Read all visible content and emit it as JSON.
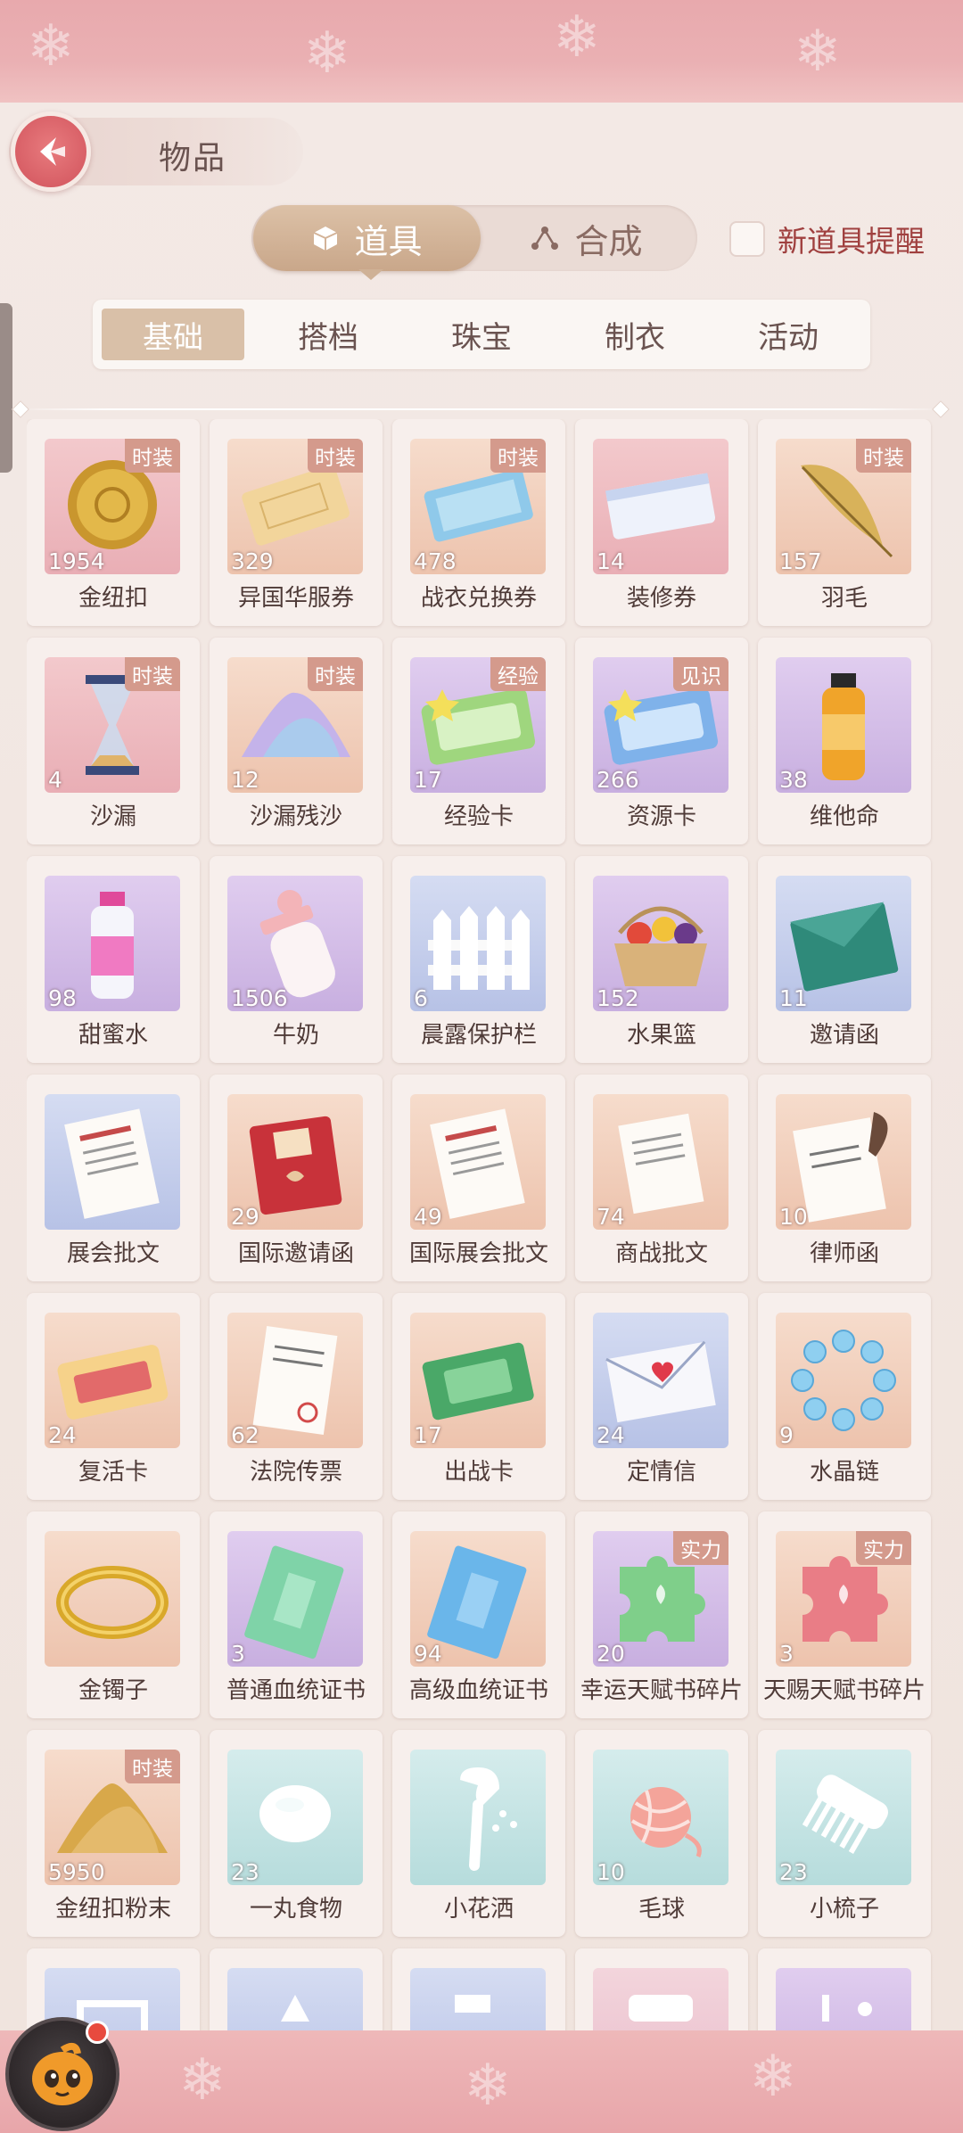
{
  "header": {
    "title": "物品"
  },
  "main_tabs": [
    {
      "label": "道具",
      "icon": "cube-icon",
      "active": true
    },
    {
      "label": "合成",
      "icon": "synthesis-icon",
      "active": false
    }
  ],
  "reminder": {
    "label": "新道具提醒",
    "checked": false
  },
  "sub_tabs": [
    {
      "label": "基础",
      "active": true
    },
    {
      "label": "搭档",
      "active": false
    },
    {
      "label": "珠宝",
      "active": false
    },
    {
      "label": "制衣",
      "active": false
    },
    {
      "label": "活动",
      "active": false
    }
  ],
  "items": [
    {
      "name": "金纽扣",
      "count": "1954",
      "badge": "时装",
      "bg": "pink",
      "icon": "gold-button-icon"
    },
    {
      "name": "异国华服券",
      "count": "329",
      "badge": "时装",
      "bg": "orange",
      "icon": "ticket-icon"
    },
    {
      "name": "战衣兑换券",
      "count": "478",
      "badge": "时装",
      "bg": "orange",
      "icon": "blue-ticket-icon"
    },
    {
      "name": "装修券",
      "count": "14",
      "badge": "",
      "bg": "pink",
      "icon": "decoration-ticket-icon"
    },
    {
      "name": "羽毛",
      "count": "157",
      "badge": "时装",
      "bg": "orange",
      "icon": "feather-icon"
    },
    {
      "name": "沙漏",
      "count": "4",
      "badge": "时装",
      "bg": "pink",
      "icon": "hourglass-icon"
    },
    {
      "name": "沙漏残沙",
      "count": "12",
      "badge": "时装",
      "bg": "orange",
      "icon": "sand-pile-icon"
    },
    {
      "name": "经验卡",
      "count": "17",
      "badge": "经验",
      "bg": "purple",
      "icon": "exp-card-icon"
    },
    {
      "name": "资源卡",
      "count": "266",
      "badge": "见识",
      "bg": "purple",
      "icon": "resource-card-icon"
    },
    {
      "name": "维他命",
      "count": "38",
      "badge": "",
      "bg": "purple",
      "icon": "vitamin-bottle-icon"
    },
    {
      "name": "甜蜜水",
      "count": "98",
      "badge": "",
      "bg": "purple",
      "icon": "sweet-water-icon"
    },
    {
      "name": "牛奶",
      "count": "1506",
      "badge": "",
      "bg": "purple",
      "icon": "milk-bottle-icon"
    },
    {
      "name": "晨露保护栏",
      "count": "6",
      "badge": "",
      "bg": "blue",
      "icon": "fence-icon"
    },
    {
      "name": "水果篮",
      "count": "152",
      "badge": "",
      "bg": "purple",
      "icon": "fruit-basket-icon"
    },
    {
      "name": "邀请函",
      "count": "11",
      "badge": "",
      "bg": "blue",
      "icon": "invitation-icon"
    },
    {
      "name": "展会批文",
      "count": "",
      "badge": "",
      "bg": "blue",
      "icon": "document-icon"
    },
    {
      "name": "国际邀请函",
      "count": "29",
      "badge": "",
      "bg": "orange",
      "icon": "red-invitation-icon"
    },
    {
      "name": "国际展会批文",
      "count": "49",
      "badge": "",
      "bg": "orange",
      "icon": "document-icon"
    },
    {
      "name": "商战批文",
      "count": "74",
      "badge": "",
      "bg": "orange",
      "icon": "letter-icon"
    },
    {
      "name": "律师函",
      "count": "10",
      "badge": "",
      "bg": "orange",
      "icon": "quill-letter-icon"
    },
    {
      "name": "复活卡",
      "count": "24",
      "badge": "",
      "bg": "orange",
      "icon": "revive-card-icon"
    },
    {
      "name": "法院传票",
      "count": "62",
      "badge": "",
      "bg": "orange",
      "icon": "summons-icon"
    },
    {
      "name": "出战卡",
      "count": "17",
      "badge": "",
      "bg": "orange",
      "icon": "battle-card-icon"
    },
    {
      "name": "定情信",
      "count": "24",
      "badge": "",
      "bg": "blue",
      "icon": "love-letter-icon"
    },
    {
      "name": "水晶链",
      "count": "9",
      "badge": "",
      "bg": "orange",
      "icon": "crystal-bracelet-icon"
    },
    {
      "name": "金镯子",
      "count": "",
      "badge": "",
      "bg": "orange",
      "icon": "gold-bangle-icon"
    },
    {
      "name": "普通血统证书",
      "count": "3",
      "badge": "",
      "bg": "purple",
      "icon": "green-certificate-icon"
    },
    {
      "name": "高级血统证书",
      "count": "94",
      "badge": "",
      "bg": "orange",
      "icon": "blue-certificate-icon"
    },
    {
      "name": "幸运天赋书碎片",
      "count": "20",
      "badge": "实力",
      "bg": "purple",
      "icon": "green-puzzle-icon"
    },
    {
      "name": "天赐天赋书碎片",
      "count": "3",
      "badge": "实力",
      "bg": "orange",
      "icon": "pink-puzzle-icon"
    },
    {
      "name": "金纽扣粉末",
      "count": "5950",
      "badge": "时装",
      "bg": "orange",
      "icon": "gold-powder-icon"
    },
    {
      "name": "一丸食物",
      "count": "23",
      "badge": "",
      "bg": "teal",
      "icon": "food-ball-icon"
    },
    {
      "name": "小花洒",
      "count": "",
      "badge": "",
      "bg": "teal",
      "icon": "shower-icon"
    },
    {
      "name": "毛球",
      "count": "10",
      "badge": "",
      "bg": "teal",
      "icon": "yarn-ball-icon"
    },
    {
      "name": "小梳子",
      "count": "23",
      "badge": "",
      "bg": "teal",
      "icon": "comb-icon"
    },
    {
      "name": "",
      "count": "",
      "badge": "",
      "bg": "blue",
      "icon": "pet-bed-icon"
    },
    {
      "name": "",
      "count": "",
      "badge": "",
      "bg": "blue",
      "icon": "toy-icon"
    },
    {
      "name": "",
      "count": "",
      "badge": "",
      "bg": "blue",
      "icon": "glove-icon"
    },
    {
      "name": "",
      "count": "",
      "badge": "",
      "bg": "pinkp",
      "icon": "pet-bowl-icon"
    },
    {
      "name": "",
      "count": "",
      "badge": "",
      "bg": "purple",
      "icon": "leash-icon"
    }
  ],
  "colors": {
    "accent": "#d85f66",
    "tab_active": "#c9a78a",
    "badge": "#d49a8c"
  }
}
